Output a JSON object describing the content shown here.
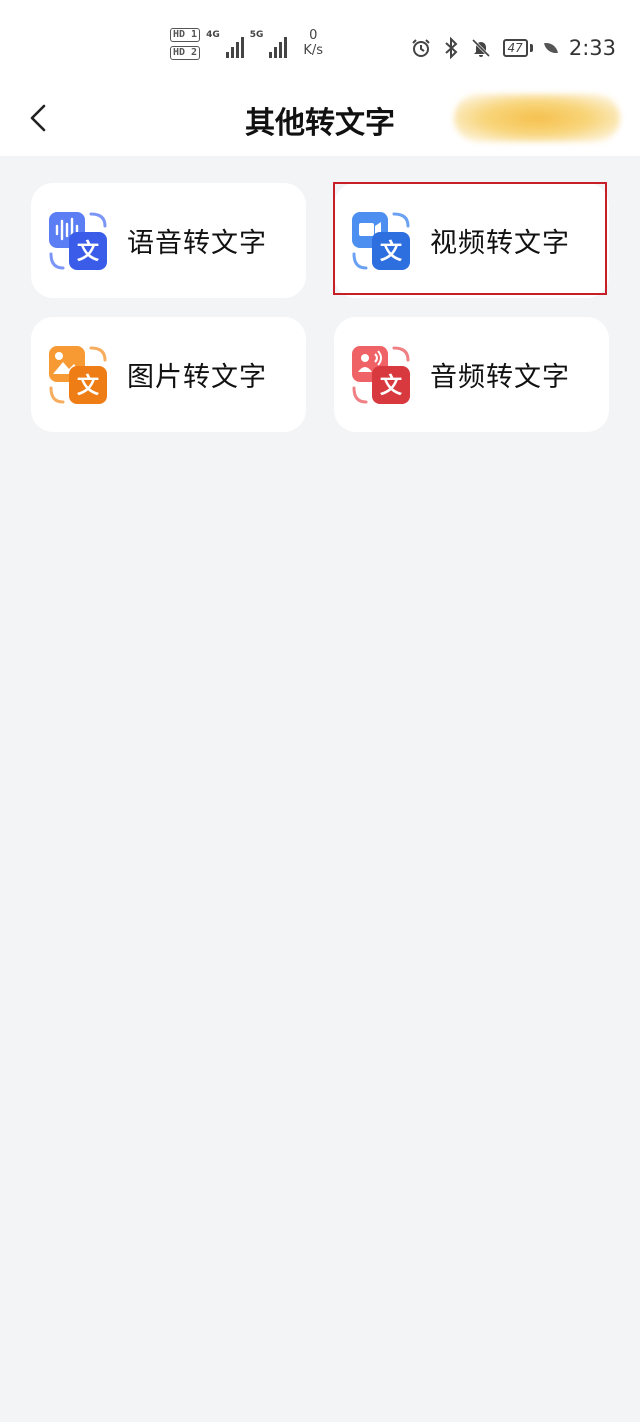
{
  "status_bar": {
    "sim1": "HD 1",
    "sim2": "HD 2",
    "net1": "4G",
    "net2": "5G",
    "speed_value": "0",
    "speed_unit": "K/s",
    "battery": "47",
    "time": "2:33"
  },
  "header": {
    "title": "其他转文字"
  },
  "cards": [
    {
      "label": "语音转文字",
      "icon": "voice-to-text-icon",
      "color": "#4a6cf0"
    },
    {
      "label": "视频转文字",
      "icon": "video-to-text-icon",
      "color": "#3d7be8"
    },
    {
      "label": "图片转文字",
      "icon": "image-to-text-icon",
      "color": "#f08a24"
    },
    {
      "label": "音频转文字",
      "icon": "audio-to-text-icon",
      "color": "#e0454a"
    }
  ],
  "icon_glyph": "文"
}
